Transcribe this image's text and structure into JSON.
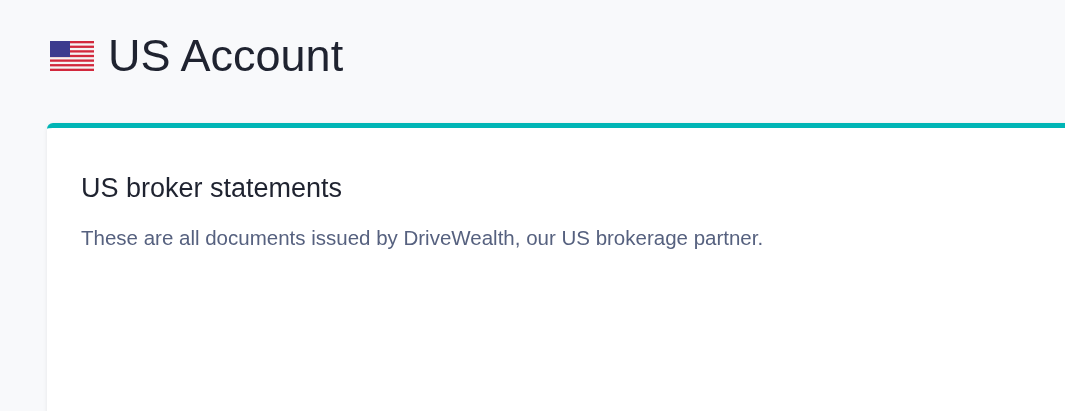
{
  "page": {
    "title": "US Account"
  },
  "card": {
    "title": "US broker statements",
    "description": "These are all documents issued by DriveWealth, our US brokerage partner."
  }
}
